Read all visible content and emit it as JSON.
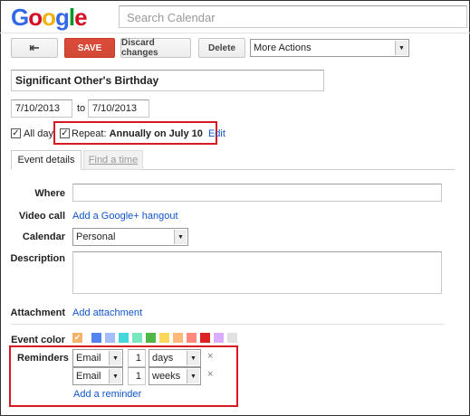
{
  "header": {
    "logo_letters": [
      {
        "ch": "G",
        "color": "#3369e8"
      },
      {
        "ch": "o",
        "color": "#d50f25"
      },
      {
        "ch": "o",
        "color": "#eeb211"
      },
      {
        "ch": "g",
        "color": "#3369e8"
      },
      {
        "ch": "l",
        "color": "#009925"
      },
      {
        "ch": "e",
        "color": "#d50f25"
      }
    ],
    "search_placeholder": "Search Calendar"
  },
  "toolbar": {
    "back_icon": "back-arrow-icon",
    "save_label": "SAVE",
    "discard_label": "Discard changes",
    "delete_label": "Delete",
    "more_actions_label": "More Actions"
  },
  "event": {
    "title": "Significant Other's Birthday",
    "start_date": "7/10/2013",
    "to_label": "to",
    "end_date": "7/10/2013",
    "all_day_label": "All day",
    "all_day_checked": true,
    "repeat_label": "Repeat:",
    "repeat_value": "Annually on July 10",
    "repeat_checked": true,
    "edit_link": "Edit"
  },
  "tabs": [
    {
      "label": "Event details",
      "active": true
    },
    {
      "label": "Find a time",
      "active": false
    }
  ],
  "details": {
    "where_label": "Where",
    "where_value": "",
    "video_label": "Video call",
    "video_link": "Add a Google+ hangout",
    "calendar_label": "Calendar",
    "calendar_value": "Personal",
    "description_label": "Description",
    "description_value": "",
    "attachment_label": "Attachment",
    "attachment_link": "Add attachment",
    "event_color_label": "Event color",
    "event_colors": [
      "#f6b26b",
      "#5484ed",
      "#a4bdfc",
      "#46d6db",
      "#7ae7bf",
      "#51b749",
      "#fbd75b",
      "#ffb878",
      "#ff887c",
      "#dc2127",
      "#dbadff",
      "#e1e1e1"
    ],
    "selected_color_check": "✔"
  },
  "reminders": {
    "label": "Reminders",
    "items": [
      {
        "method": "Email",
        "amount": "1",
        "unit": "days"
      },
      {
        "method": "Email",
        "amount": "1",
        "unit": "weeks"
      }
    ],
    "remove_symbol": "×",
    "add_link": "Add a reminder"
  }
}
